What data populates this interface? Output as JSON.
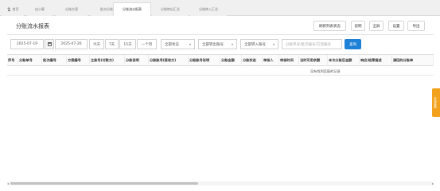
{
  "tabs": [
    {
      "label": "首页"
    },
    {
      "label": "店小蜜"
    },
    {
      "label": "分账方案"
    },
    {
      "label": "批次分账"
    },
    {
      "label": "分账流水报表"
    },
    {
      "label": "分账转出汇总"
    },
    {
      "label": "分账转入汇总"
    }
  ],
  "page_title": "分账流水报表",
  "toolbar": {
    "refresh": "刷新列表状态",
    "help": "说明",
    "fullscreen": "全屏",
    "settings": "设置",
    "export": "导出"
  },
  "filters": {
    "date_start": "2025-07-19",
    "date_end": "2025-07-26",
    "quick_today": "今天",
    "quick_7": "7天",
    "quick_15": "15天",
    "quick_month": "一个月",
    "status_select": "全部状态",
    "out_account_select": "全部转出账号",
    "in_account_select": "全部转入账号",
    "search_placeholder": "分账单号/批次编号/方案编号",
    "query_button": "查询"
  },
  "table": {
    "columns": [
      "序号",
      "分账单号",
      "批次编号",
      "方案编号",
      "主账号(付款方)",
      "分账说明",
      "分账账号(接收方)",
      "分账账号说明",
      "分账金额",
      "分账状态",
      "审核人",
      "审核时间",
      "当时可用余额",
      "本次分账后金额",
      "响应/结果描述",
      "源回的分账单"
    ],
    "empty_text": "没有找到匹配的记录"
  },
  "side_tab": "在线客服"
}
